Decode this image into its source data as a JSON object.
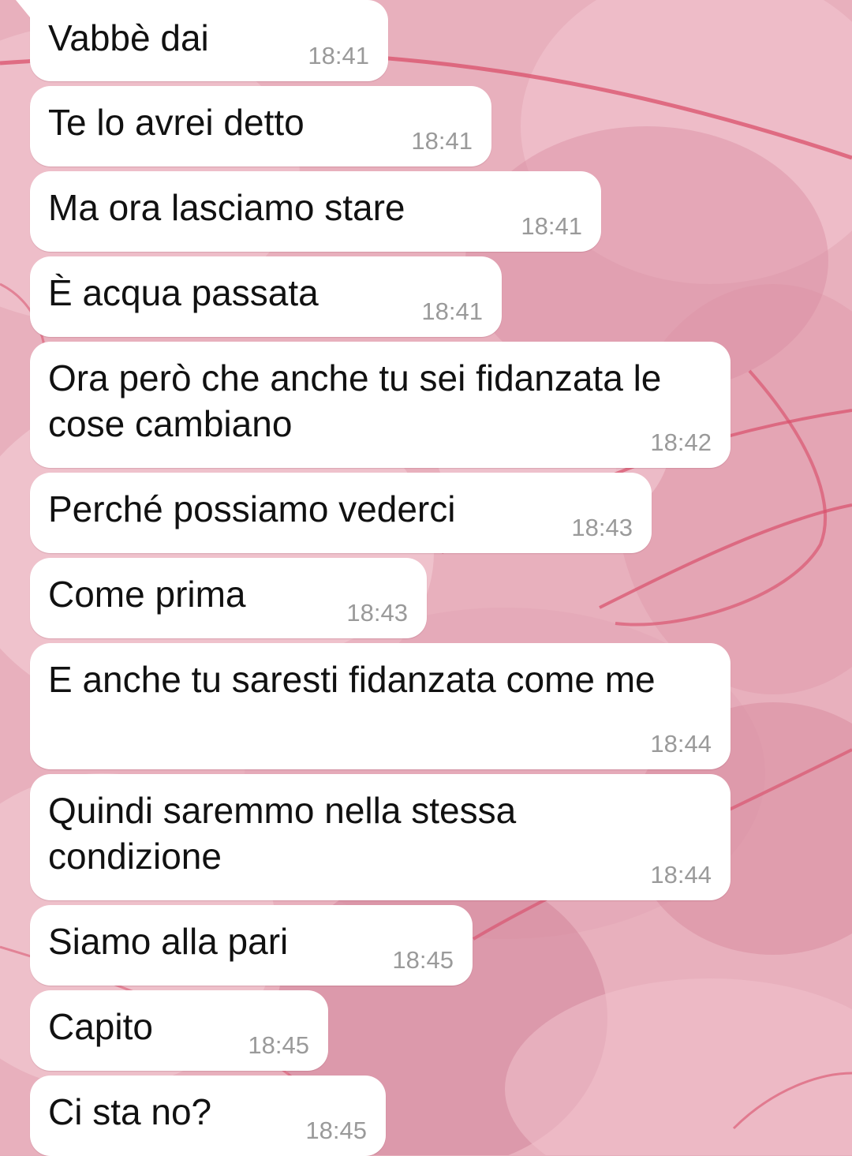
{
  "wallpaper": {
    "base_color": "#e7aebb",
    "accent_color": "#d9506b"
  },
  "messages": [
    {
      "text": "Vabbè dai",
      "time": "18:41"
    },
    {
      "text": "Te lo avrei detto",
      "time": "18:41"
    },
    {
      "text": "Ma ora lasciamo stare",
      "time": "18:41"
    },
    {
      "text": "È acqua passata",
      "time": "18:41"
    },
    {
      "text": "Ora però che anche tu sei fidanzata le cose cambiano",
      "time": "18:42"
    },
    {
      "text": "Perché possiamo vederci",
      "time": "18:43"
    },
    {
      "text": "Come prima",
      "time": "18:43"
    },
    {
      "text": "E anche tu saresti fidanzata come me",
      "time": "18:44"
    },
    {
      "text": "Quindi saremmo nella stessa condizione",
      "time": "18:44"
    },
    {
      "text": "Siamo alla pari",
      "time": "18:45"
    },
    {
      "text": "Capito",
      "time": "18:45"
    },
    {
      "text": "Ci sta no?",
      "time": "18:45"
    }
  ]
}
